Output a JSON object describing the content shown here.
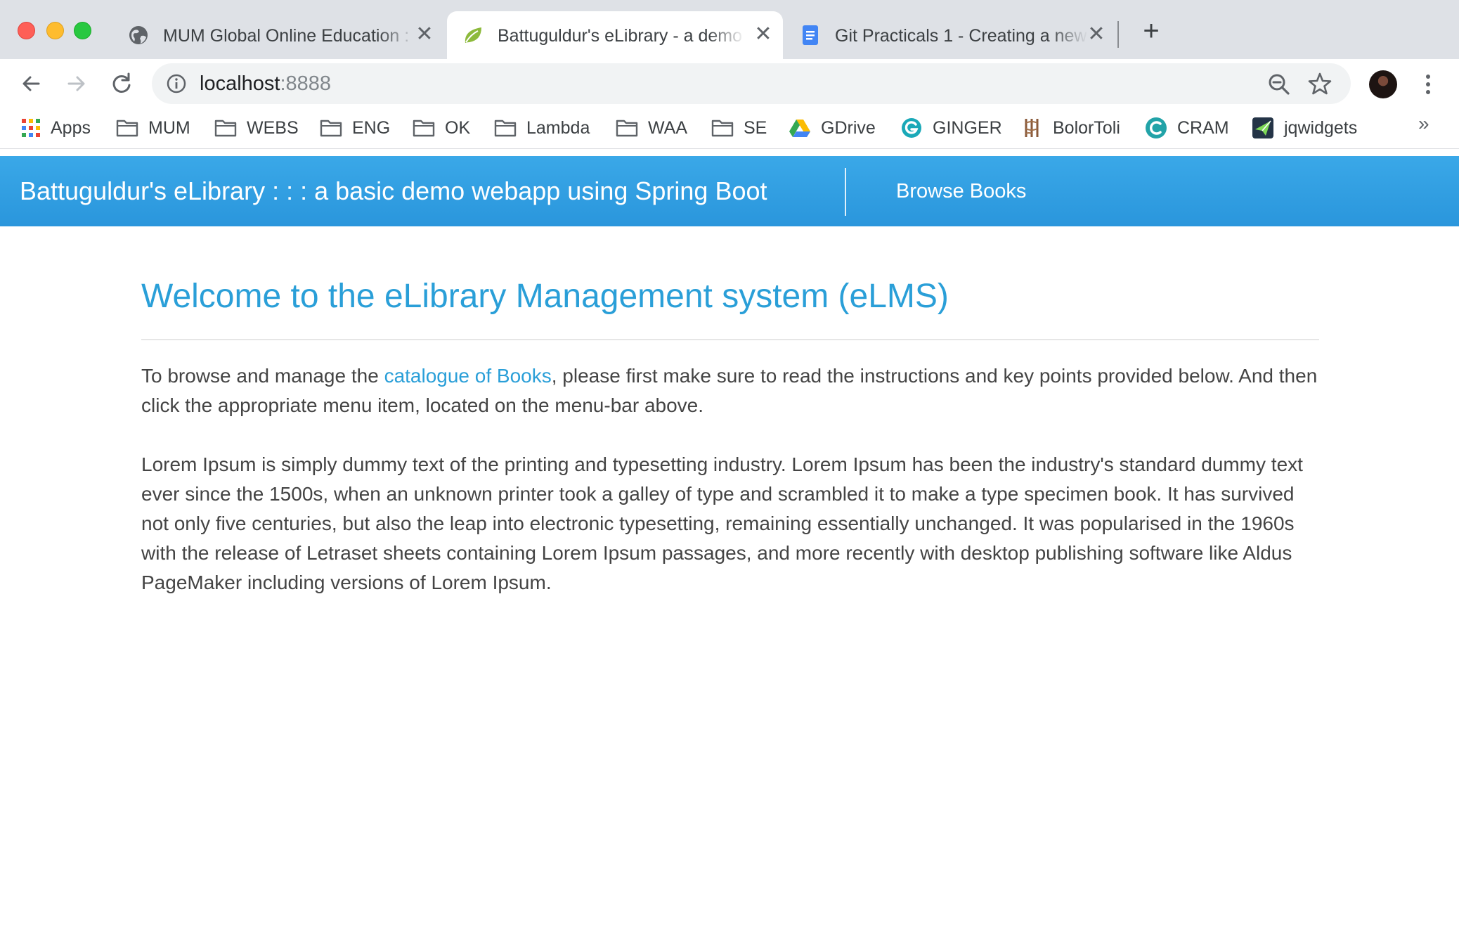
{
  "browser": {
    "tabs": [
      {
        "title": "MUM Global Online Education :",
        "icon": "globe-icon",
        "active": false
      },
      {
        "title": "Battuguldur's eLibrary - a demo",
        "icon": "spring-leaf-icon",
        "active": true
      },
      {
        "title": "Git Practicals 1 - Creating a new",
        "icon": "google-docs-icon",
        "active": false
      }
    ],
    "tab_close_glyph": "✕",
    "new_tab_glyph": "+",
    "address": {
      "host": "localhost",
      "port": ":8888"
    },
    "bookmarks": [
      {
        "label": "Apps",
        "icon": "apps-grid-icon"
      },
      {
        "label": "MUM",
        "icon": "folder-icon"
      },
      {
        "label": "WEBS",
        "icon": "folder-icon"
      },
      {
        "label": "ENG",
        "icon": "folder-icon"
      },
      {
        "label": "OK",
        "icon": "folder-icon"
      },
      {
        "label": "Lambda",
        "icon": "folder-icon"
      },
      {
        "label": "WAA",
        "icon": "folder-icon"
      },
      {
        "label": "SE",
        "icon": "folder-icon"
      },
      {
        "label": "GDrive",
        "icon": "google-drive-icon"
      },
      {
        "label": "GINGER",
        "icon": "ginger-icon"
      },
      {
        "label": "BolorToli",
        "icon": "bolortoli-icon"
      },
      {
        "label": "CRAM",
        "icon": "cram-icon"
      },
      {
        "label": "jqwidgets",
        "icon": "jqwidgets-icon"
      }
    ],
    "bookmarks_overflow": "»"
  },
  "navbar": {
    "brand": "Battuguldur's eLibrary : : : a basic demo webapp using Spring Boot",
    "link": "Browse Books",
    "color": "#2f9ee0"
  },
  "main": {
    "heading": "Welcome to the eLibrary Management system (eLMS)",
    "intro_before": "To browse and manage the ",
    "intro_link": "catalogue of Books",
    "intro_after": ", please first make sure to read the instructions and key points provided below. And then click the appropriate menu item, located on the menu-bar above.",
    "lorem": "Lorem Ipsum is simply dummy text of the printing and typesetting industry. Lorem Ipsum has been the industry's standard dummy text ever since the 1500s, when an unknown printer took a galley of type and scrambled it to make a type specimen book. It has survived not only five centuries, but also the leap into electronic typesetting, remaining essentially unchanged. It was popularised in the 1960s with the release of Letraset sheets containing Lorem Ipsum passages, and more recently with desktop publishing software like Aldus PageMaker including versions of Lorem Ipsum.",
    "accent_color": "#2a9fd8"
  }
}
